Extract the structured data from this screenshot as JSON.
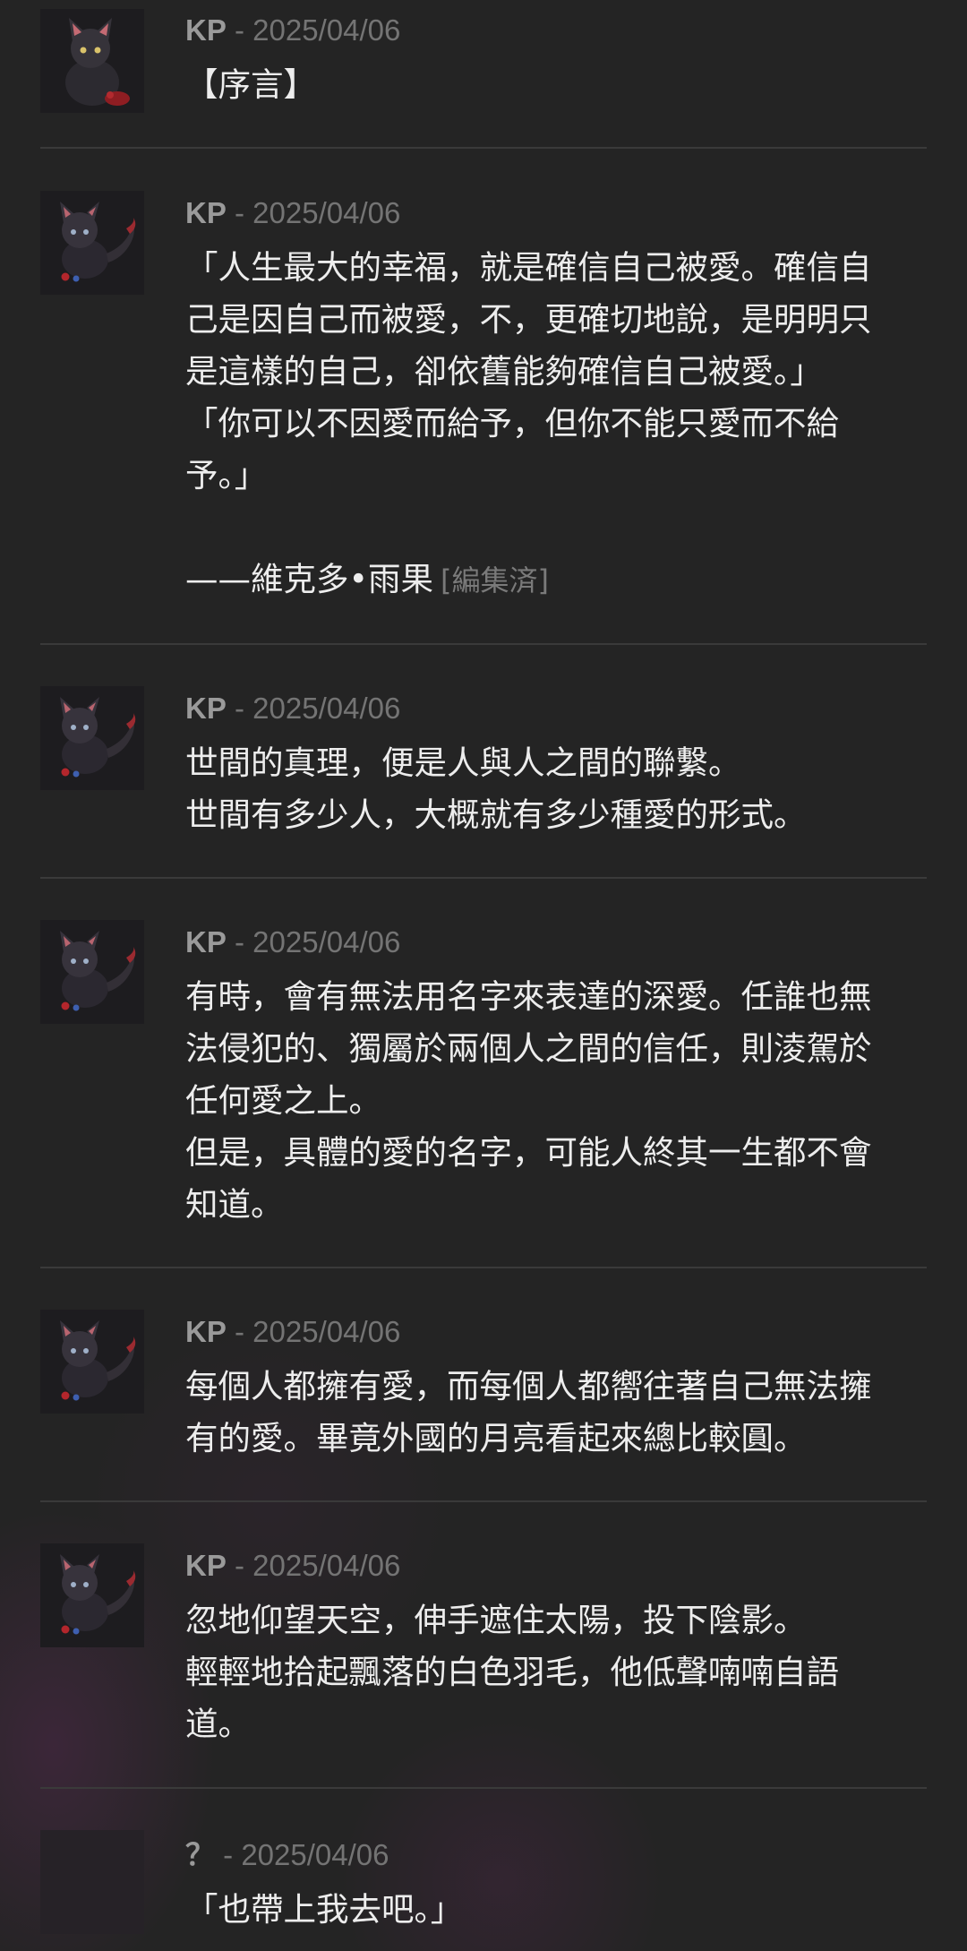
{
  "posts": [
    {
      "author": "KP",
      "separator": " - ",
      "date": "2025/04/06",
      "avatar_icon": "black-cat-avatar-icon",
      "lines": [
        "【序言】"
      ]
    },
    {
      "author": "KP",
      "separator": " - ",
      "date": "2025/04/06",
      "avatar_icon": "black-cat-avatar-icon",
      "lines": [
        "「人生最大的幸福，就是確信自己被愛。確信自",
        "己是因自己而被愛，不，更確切地說，是明明只",
        "是這樣的自己，卻依舊能夠確信自己被愛。」",
        "「你可以不因愛而給予，但你不能只愛而不給",
        "予。」",
        "",
        "——維克多•雨果"
      ],
      "edited_label": "[編集済]"
    },
    {
      "author": "KP",
      "separator": " - ",
      "date": "2025/04/06",
      "avatar_icon": "black-cat-avatar-icon",
      "lines": [
        "世間的真理，便是人與人之間的聯繫。",
        "世間有多少人，大概就有多少種愛的形式。"
      ]
    },
    {
      "author": "KP",
      "separator": " - ",
      "date": "2025/04/06",
      "avatar_icon": "black-cat-avatar-icon",
      "lines": [
        "有時，會有無法用名字來表達的深愛。任誰也無",
        "法侵犯的、獨屬於兩個人之間的信任，則淩駕於",
        "任何愛之上。",
        "但是，具體的愛的名字，可能人終其一生都不會",
        "知道。"
      ]
    },
    {
      "author": "KP",
      "separator": " - ",
      "date": "2025/04/06",
      "avatar_icon": "black-cat-avatar-icon",
      "lines": [
        "每個人都擁有愛，而每個人都嚮往著自己無法擁",
        "有的愛。畢竟外國的月亮看起來總比較圓。"
      ]
    },
    {
      "author": "KP",
      "separator": " - ",
      "date": "2025/04/06",
      "avatar_icon": "black-cat-avatar-icon",
      "lines": [
        "忽地仰望天空，伸手遮住太陽，投下陰影。",
        "輕輕地拾起飄落的白色羽毛，他低聲喃喃自語",
        "道。"
      ]
    },
    {
      "author": "？",
      "separator": " - ",
      "date": "2025/04/06",
      "avatar_icon": "blank-avatar-icon",
      "lines": [
        "「也帶上我去吧。」"
      ]
    }
  ]
}
